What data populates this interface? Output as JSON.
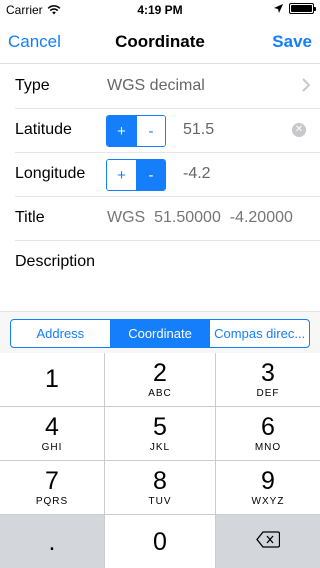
{
  "status_bar": {
    "carrier": "Carrier",
    "time": "4:19 PM",
    "icons": [
      "wifi-icon",
      "location-arrow-icon",
      "battery-icon"
    ]
  },
  "navbar": {
    "cancel": "Cancel",
    "title": "Coordinate",
    "save": "Save"
  },
  "form": {
    "type": {
      "label": "Type",
      "value": "WGS decimal"
    },
    "latitude": {
      "label": "Latitude",
      "plus": "+",
      "minus": "-",
      "value": "51.5",
      "selected_sign": "+"
    },
    "longitude": {
      "label": "Longitude",
      "plus": "+",
      "minus": "-",
      "value": "-4.2",
      "selected_sign": "-"
    },
    "title": {
      "label": "Title",
      "placeholder": "WGS  51.50000  -4.20000"
    },
    "description": {
      "label": "Description"
    }
  },
  "segmented": {
    "options": [
      "Address",
      "Coordinate",
      "Compas direc..."
    ],
    "selected": "Coordinate"
  },
  "keypad": {
    "keys": [
      {
        "num": "1",
        "letters": ""
      },
      {
        "num": "2",
        "letters": "ABC"
      },
      {
        "num": "3",
        "letters": "DEF"
      },
      {
        "num": "4",
        "letters": "GHI"
      },
      {
        "num": "5",
        "letters": "JKL"
      },
      {
        "num": "6",
        "letters": "MNO"
      },
      {
        "num": "7",
        "letters": "PQRS"
      },
      {
        "num": "8",
        "letters": "TUV"
      },
      {
        "num": "9",
        "letters": "WXYZ"
      }
    ],
    "dot": ".",
    "zero": "0",
    "delete_icon": "backspace-icon"
  },
  "colors": {
    "accent": "#147efb",
    "keypad_bg": "#c9cdd3"
  }
}
